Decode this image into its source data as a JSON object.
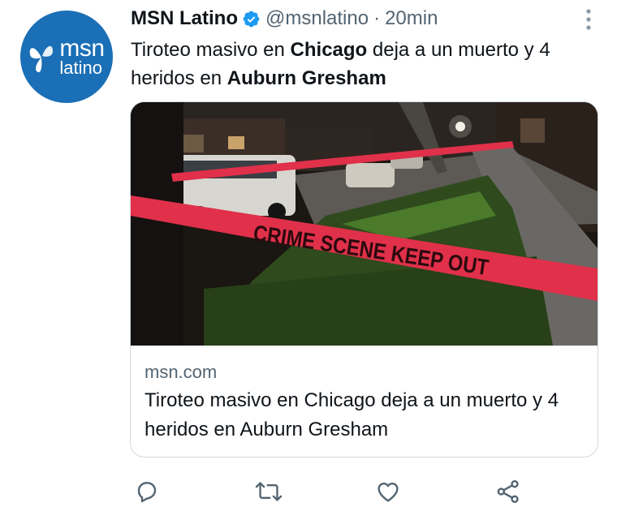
{
  "tweet": {
    "author": {
      "name": "MSN Latino",
      "handle": "@msnlatino",
      "verified": true,
      "avatar": {
        "line1": "msn",
        "line2": "latino",
        "color": "#1b6fb6"
      }
    },
    "separator": "·",
    "time": "20min",
    "text": {
      "part1": "Tiroteo masivo en ",
      "bold1": "Chicago",
      "part2": " deja a un muerto y 4 heridos en ",
      "bold2": "Auburn Gresham"
    },
    "card": {
      "image_tape_text": "CRIME SCENE KEEP OUT",
      "domain": "msn.com",
      "title": "Tiroteo masivo en Chicago deja a un muerto y 4 heridos en Auburn Gresham"
    },
    "actions": [
      {
        "name": "reply",
        "icon": "reply-icon"
      },
      {
        "name": "retweet",
        "icon": "retweet-icon"
      },
      {
        "name": "like",
        "icon": "heart-icon"
      },
      {
        "name": "share",
        "icon": "share-icon"
      }
    ]
  },
  "colors": {
    "accent": "#1d9bf0",
    "secondary_text": "#536471",
    "primary_text": "#0f1419",
    "border": "#cfd9de",
    "tape": "#e0304a"
  }
}
